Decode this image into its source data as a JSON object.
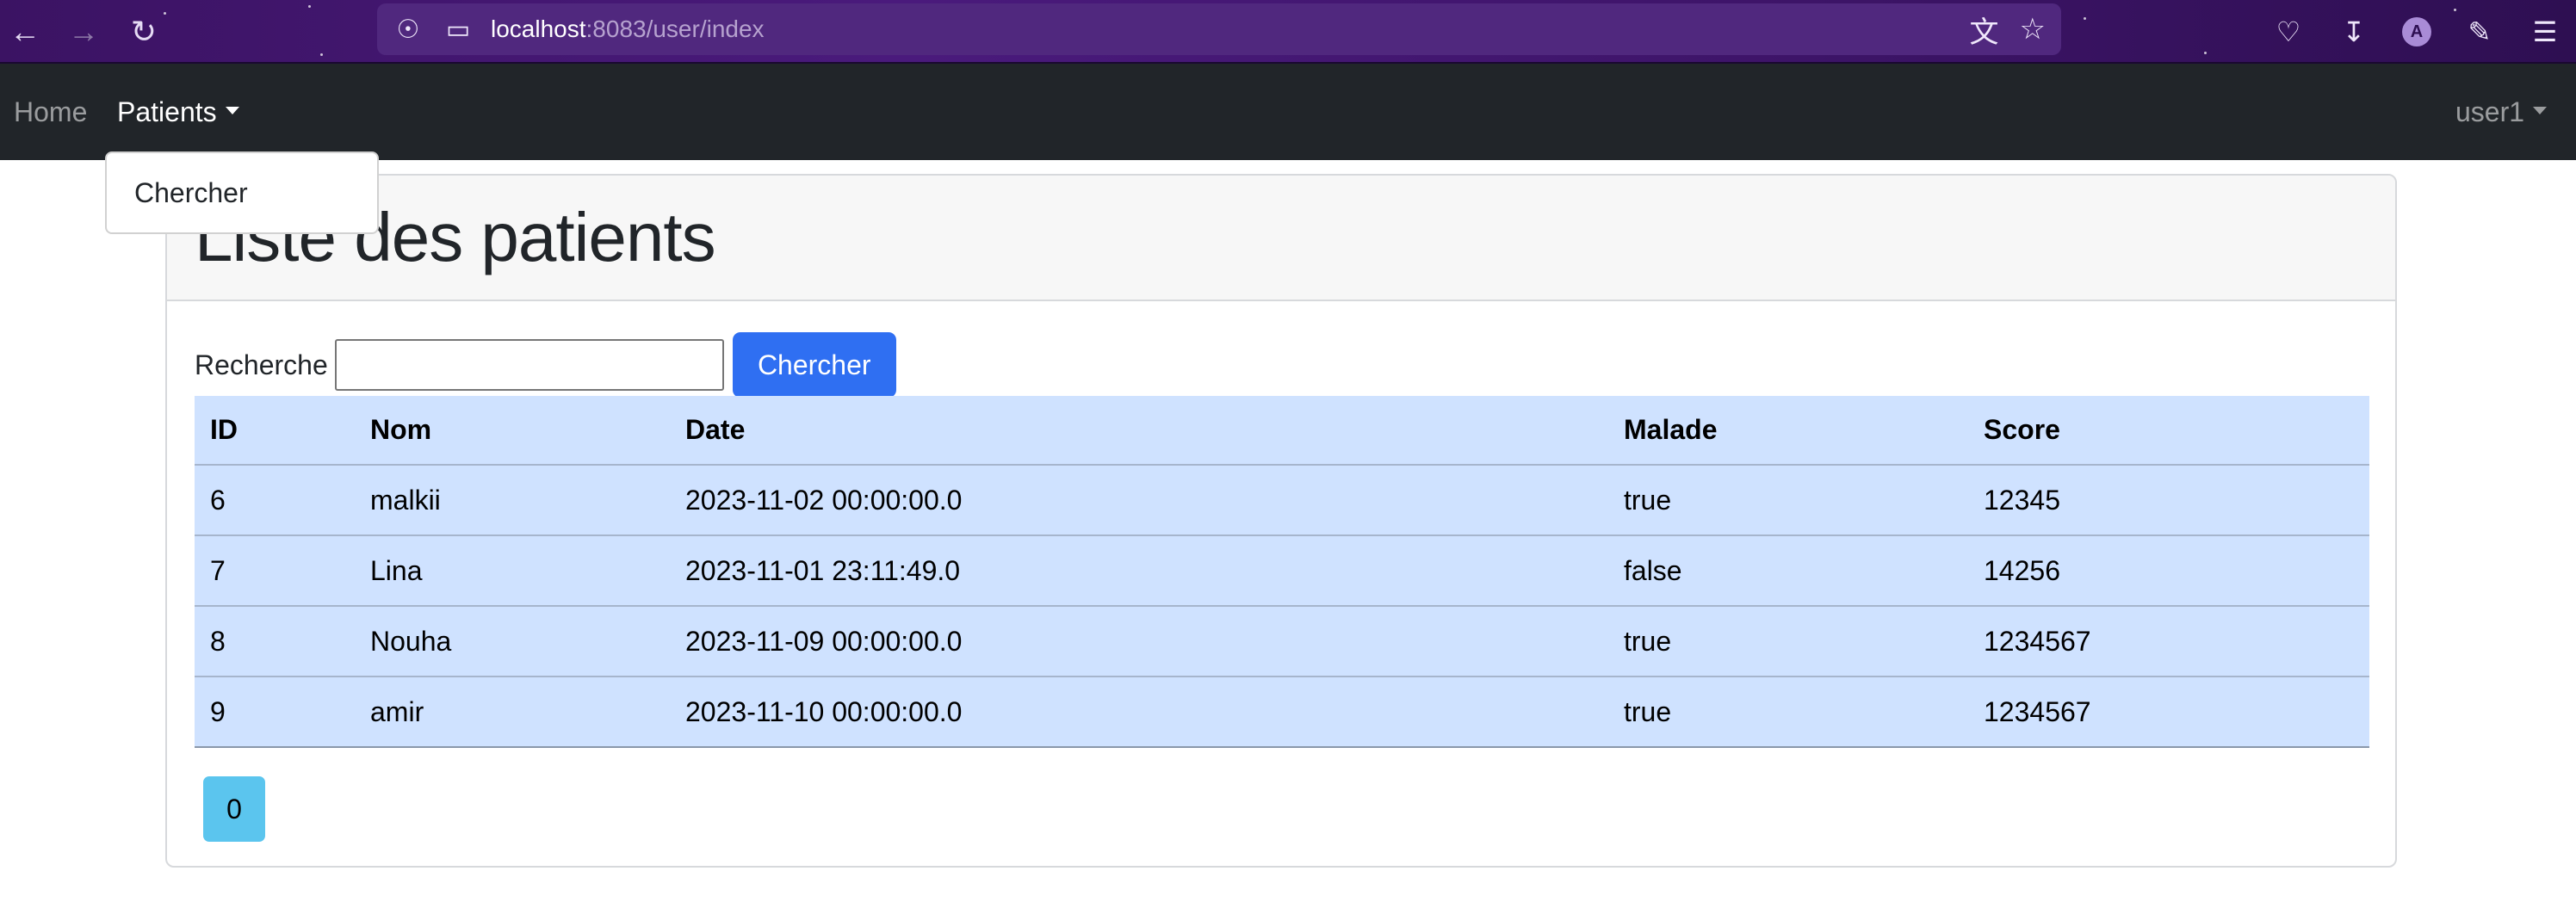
{
  "browser": {
    "url_host": "localhost",
    "url_path": ":8083/user/index",
    "back_icon": "arrow-left-icon",
    "forward_icon": "arrow-right-icon",
    "reload_icon": "reload-icon",
    "avatar_letter": "A"
  },
  "navbar": {
    "home_label": "Home",
    "patients_label": "Patients",
    "user_label": "user1"
  },
  "dropdown": {
    "items": [
      {
        "label": "Chercher"
      }
    ]
  },
  "page": {
    "title": "Liste des patients",
    "search_label": "Recherche",
    "search_value": "",
    "search_button": "Chercher"
  },
  "table": {
    "headers": [
      "ID",
      "Nom",
      "Date",
      "Malade",
      "Score"
    ],
    "rows": [
      [
        "6",
        "malkii",
        "2023-11-02 00:00:00.0",
        "true",
        "12345"
      ],
      [
        "7",
        "Lina",
        "2023-11-01 23:11:49.0",
        "false",
        "14256"
      ],
      [
        "8",
        "Nouha",
        "2023-11-09 00:00:00.0",
        "true",
        "1234567"
      ],
      [
        "9",
        "amir",
        "2023-11-10 00:00:00.0",
        "true",
        "1234567"
      ]
    ]
  },
  "pagination": {
    "pages": [
      "0"
    ]
  },
  "colors": {
    "navbar_bg": "#212529",
    "primary": "#2f6ff2",
    "table_bg": "#cfe2ff",
    "page_btn": "#5bc5ee"
  }
}
